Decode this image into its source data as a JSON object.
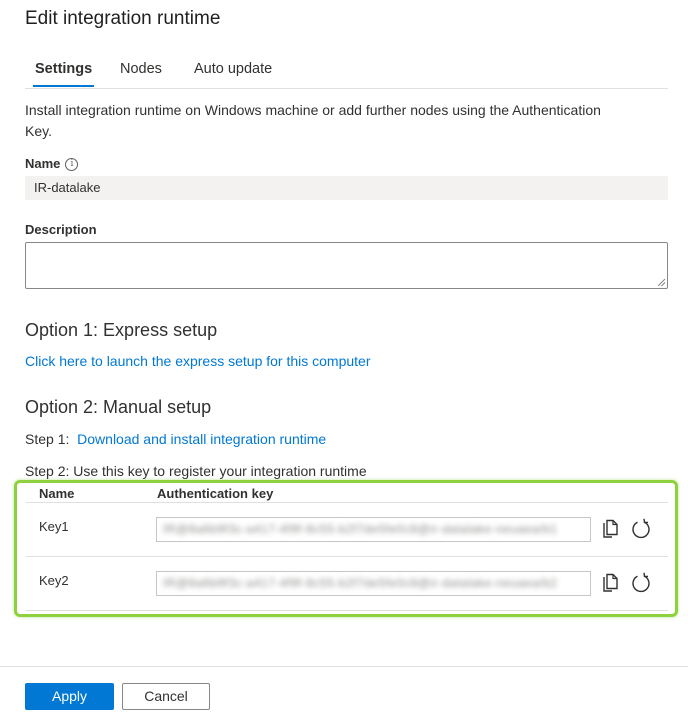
{
  "dialog": {
    "title": "Edit integration runtime"
  },
  "tabs": [
    {
      "label": "Settings",
      "active": true
    },
    {
      "label": "Nodes",
      "active": false
    },
    {
      "label": "Auto update",
      "active": false
    }
  ],
  "intro": "Install integration runtime on Windows machine or add further nodes using the Authentication Key.",
  "name_field": {
    "label": "Name",
    "value": "IR-datalake",
    "info_icon": "info-icon"
  },
  "description_field": {
    "label": "Description",
    "value": ""
  },
  "option1": {
    "heading": "Option 1: Express setup",
    "link": "Click here to launch the express setup for this computer"
  },
  "option2": {
    "heading": "Option 2: Manual setup",
    "step1_label": "Step 1:",
    "step1_link": "Download and install integration runtime",
    "step2": "Step 2: Use this key to register your integration runtime"
  },
  "keys_table": {
    "headers": [
      "Name",
      "Authentication key"
    ],
    "rows": [
      {
        "name": "Key1",
        "value": "IR@8a6b9f3c-a417-4f9f-8c55-b2f7de5fe0c8@ir-datalake-neuaea/b1"
      },
      {
        "name": "Key2",
        "value": "IR@8a6b9f3c-a417-4f9f-8c55-b2f7de5fe0c8@ir-datalake-neuaea/b2"
      }
    ],
    "row_actions": [
      "copy-icon",
      "refresh-icon"
    ]
  },
  "footer": {
    "apply_label": "Apply",
    "cancel_label": "Cancel"
  },
  "colors": {
    "accent": "#0078d4",
    "highlight": "#8ed13f",
    "readonly_bg": "#f3f2f1"
  }
}
